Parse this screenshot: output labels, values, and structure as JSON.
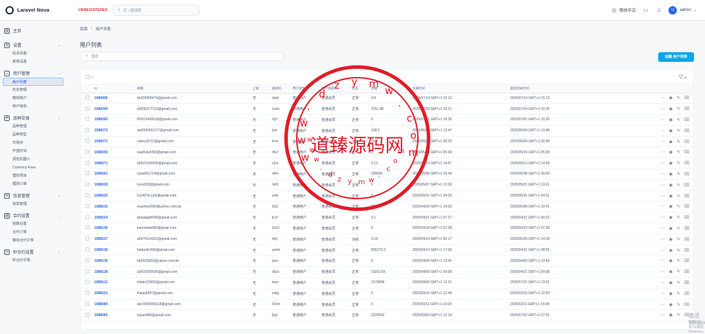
{
  "topbar": {
    "app_name": "Laravel Nova",
    "badge": "UNREGISTERED",
    "search_placeholder": "仅 / 键搜索",
    "language": "简体中文",
    "user": "admin",
    "avatar_letter": "U"
  },
  "sidebar": {
    "groups": [
      {
        "label": "主页",
        "items": []
      },
      {
        "label": "设置",
        "items": [
          "站点设置",
          "常规设置"
        ]
      },
      {
        "label": "用户管理",
        "items": [
          "用户列表",
          "实名管理",
          "模拟账户",
          "用户钱包"
        ]
      },
      {
        "label": "品种交易",
        "items": [
          "品种管理",
          "品种类型",
          "交易对",
          "开盘时间",
          "调控机器人",
          "Currency Kxes",
          "理财项目",
          "理财订单"
        ]
      },
      {
        "label": "信息管理",
        "items": [
          "信息管理"
        ]
      },
      {
        "label": "合约设置",
        "items": [
          "倍数设置",
          "合约订单",
          "模拟合约订单"
        ]
      },
      {
        "label": "秒合约设置",
        "items": [
          "秒合约交易"
        ]
      }
    ],
    "active_item": "用户列表"
  },
  "page": {
    "breadcrumb": [
      "资源",
      "用户列表"
    ],
    "title": "用户列表",
    "search_placeholder": "搜索",
    "create_button": "创建 用户列表"
  },
  "table": {
    "columns": [
      "ID",
      "邮箱",
      "上级",
      "邀请码",
      "用户类型",
      "用户等级",
      "状态",
      "余额",
      "注册时间",
      "最后登录时间"
    ],
    "rows": [
      [
        "1088406",
        "kk225968476@gmail.com",
        "无",
        "nlwh",
        "普通用户",
        "普通会员",
        "正常",
        "0.8",
        "2025/07/14 GMT+1 15:13",
        "2025/07/14 GMT+1 15:13"
      ],
      [
        "1088399",
        "a0936217310@gmail.com",
        "无",
        "1row",
        "普通用户",
        "普通会员",
        "正常",
        "3761.48",
        "2025/07/03 GMT+1 16:21",
        "2025/07/24 GMT+1 15:30"
      ],
      [
        "1088392",
        "P0912499518@gmail.com",
        "无",
        "hj2l",
        "普通用户",
        "普通会员",
        "正常",
        "0",
        "2025/07/01 GMT+1 15:35",
        "2025/07/01 GMT+1 15:35"
      ],
      [
        "1088373",
        "aa0906351177@gmail.com",
        "无",
        "lyer",
        "普通用户",
        "普通会员",
        "正常",
        "168.2",
        "2025/06/04 GMT+1 13:47",
        "2025/06/04 GMT+1 13:48"
      ],
      [
        "1088371",
        "nawoy5713@gmail.com",
        "无",
        "krvo",
        "普通用户",
        "普通会员",
        "正常",
        "152",
        "2025/06/04 GMT+1 06:23",
        "2025/06/04 GMT+1 16:45"
      ],
      [
        "1088293",
        "luadhaluf350@gmail.com",
        "无",
        "r8s7",
        "普通用户",
        "普通会员",
        "正常",
        "0",
        "2025/05/19 GMT+1 05:39",
        "2025/05/19 GMT+1 05:39"
      ],
      [
        "1088271",
        "b0923190094@gmail.com",
        "无",
        "u2vr",
        "普通用户",
        "普通会员",
        "正常",
        "0.12",
        "2025/05/13 GMT+1 14:57",
        "2025/05/13 GMT+1 14:58"
      ],
      [
        "1088261",
        "xyao061724@gmail.com",
        "无",
        "ohm",
        "普通用户",
        "普通会员",
        "正常",
        "200000",
        "2025/05/08 GMT+1 15:49",
        "2025/05/08 GMT+1 15:50"
      ],
      [
        "1088228",
        "moxi330@gmail.com",
        "无",
        "h4l3",
        "普通用户",
        "普通会员",
        "正常",
        "0",
        "2025/05/07 GMT+1 13:30",
        "2025/05/01 GMT+1 13:31"
      ],
      [
        "1088220",
        "ILEAP3LLEN@gmail.com",
        "无",
        "yxtb",
        "普通用户",
        "普通会员",
        "正常",
        "0",
        "2025/05/01 GMT+1 04:29",
        "2025/05/01 GMT+1 04:31"
      ],
      [
        "1088215",
        "mayline0900@yahoo.com.tw",
        "无",
        "3l11",
        "普通用户",
        "普通会员",
        "正常",
        "898.4",
        "2025/04/29 GMT+1 14:03",
        "2025/05/08 GMT+1 10:41"
      ],
      [
        "1088154",
        "tanpalpa8000@gmail.com",
        "无",
        "jt14",
        "普通用户",
        "普通会员",
        "正常",
        "0.1",
        "2025/04/21 GMT+1 07:27",
        "2025/04/21 GMT+1 09:02"
      ],
      [
        "1088145",
        "karenliaw686@gmail.com",
        "无",
        "5c63",
        "普通用户",
        "普通会员",
        "正常",
        "0",
        "2025/04/18 GMT+1 07:28",
        "2025/04/23 GMT+1 07:28"
      ],
      [
        "1088137",
        "a0979114022@gmail.com",
        "无",
        "xhtj",
        "普通用户",
        "普通会员",
        "冻结",
        "0.18",
        "2025/04/14 GMT+1 05:17",
        "2025/05/26 GMT+1 14:18"
      ],
      [
        "1088136",
        "haitaolin258@gmail.com",
        "无",
        "yemk",
        "普通用户",
        "普通会员",
        "正常",
        "835279.3",
        "2025/04/13 GMT+1 17:06",
        "2025/04/21 GMT+1 08:55"
      ],
      [
        "1088130",
        "bb2625000@yahoo.com.tw",
        "无",
        "pics",
        "普通用户",
        "普通会员",
        "正常",
        "0",
        "2025/04/09 GMT+1 13:42",
        "2025/04/09 GMT+1 13:59"
      ],
      [
        "1088128",
        "a0915003695@gmail.com",
        "无",
        "db2z",
        "普通用户",
        "普通会员",
        "正常",
        "31152.65",
        "2025/04/09 GMT+1 09:08",
        "2025/04/21 GMT+1 09:08"
      ],
      [
        "1088112",
        "lzhibo21900@gmail.com",
        "无",
        "taan",
        "普通用户",
        "普通会员",
        "正常",
        "1576806",
        "2025/04/03 GMT+1 12:21",
        "2025/07/21 GMT+1 13:51"
      ],
      [
        "1088101",
        "Kanja5807@gmail.com",
        "无",
        "wxlg",
        "普通用户",
        "普通会员",
        "正常",
        "0",
        "2025/03/15 GMT+1 12:49",
        "2025/03/15 GMT+1 12:50"
      ],
      [
        "1088084",
        "abc0930956118@gmail.com",
        "无",
        "h2xm",
        "普通用户",
        "普通会员",
        "正常",
        "0",
        "2025/03/11 GMT+1 15:00",
        "2025/03/11 GMT+1 15:08"
      ],
      [
        "1088065",
        "lziyan460@gmail.com",
        "无",
        "j5pl",
        "普通用户",
        "普通会员",
        "正常",
        "2225832",
        "2025/03/04 GMT+1 12:14",
        "2025/07/02 GMT+1 17:01"
      ]
    ]
  },
  "watermark": {
    "text": "道臻源码网",
    "arc_letters": [
      "w",
      "w",
      "w",
      ".",
      "d",
      "z",
      "y",
      "m",
      "w",
      ".",
      "c",
      "o",
      "m"
    ],
    "windows_title": "激活 Windows",
    "windows_sub": "转到\"设置\"以激活 Windows。",
    "color": "#e11d27"
  },
  "colors": {
    "accent": "#0ea5e9",
    "link": "#2563eb"
  }
}
